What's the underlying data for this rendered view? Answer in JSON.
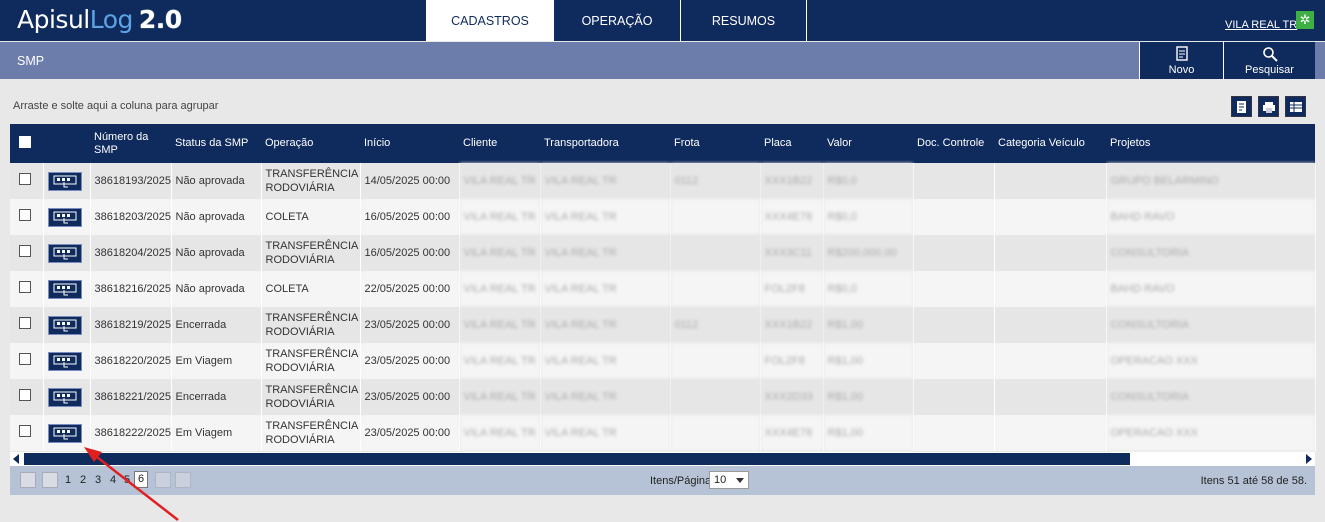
{
  "brand": {
    "name_a": "Apisul",
    "name_b": "Log",
    "version": "2.0"
  },
  "nav": {
    "tabs": [
      {
        "label": "CADASTROS"
      },
      {
        "label": "OPERAÇÃO"
      },
      {
        "label": "RESUMOS"
      }
    ],
    "active": 0
  },
  "user": {
    "name": "VILA REAL TR"
  },
  "section": {
    "title": "SMP",
    "new_label": "Novo",
    "search_label": "Pesquisar"
  },
  "grid": {
    "group_hint": "Arraste e solte aqui a coluna para agrupar",
    "columns": [
      "Número da SMP",
      "Status da SMP",
      "Operação",
      "Início",
      "Cliente",
      "Transportadora",
      "Frota",
      "Placa",
      "Valor",
      "Doc. Controle",
      "Categoria Veículo",
      "Projetos"
    ],
    "rows": [
      {
        "numero": "38618193/2025",
        "status": "Não aprovada",
        "operacao": "TRANSFERÊNCIA RODOVIÁRIA",
        "inicio": "14/05/2025 00:00",
        "cliente": "VILA REAL TR",
        "transportadora": "VILA REAL TR",
        "frota": "0112",
        "placa": "XXX1B22",
        "valor": "R$0,0",
        "projetos": "GRUPO BELARMINO"
      },
      {
        "numero": "38618203/2025",
        "status": "Não aprovada",
        "operacao": "COLETA",
        "inicio": "16/05/2025 00:00",
        "cliente": "VILA REAL TR",
        "transportadora": "VILA REAL TR",
        "frota": "",
        "placa": "XXX4E78",
        "valor": "R$0,0",
        "projetos": "BAHD RAVO"
      },
      {
        "numero": "38618204/2025",
        "status": "Não aprovada",
        "operacao": "TRANSFERÊNCIA RODOVIÁRIA",
        "inicio": "16/05/2025 00:00",
        "cliente": "VILA REAL TR",
        "transportadora": "VILA REAL TR",
        "frota": "",
        "placa": "XXX3C11",
        "valor": "R$200,000.00",
        "projetos": "CONSULTORIA"
      },
      {
        "numero": "38618216/2025",
        "status": "Não aprovada",
        "operacao": "COLETA",
        "inicio": "22/05/2025 00:00",
        "cliente": "VILA REAL TR",
        "transportadora": "VILA REAL TR",
        "frota": "",
        "placa": "FOL2F8",
        "valor": "R$0,0",
        "projetos": "BAHD RAVO"
      },
      {
        "numero": "38618219/2025",
        "status": "Encerrada",
        "operacao": "TRANSFERÊNCIA RODOVIÁRIA",
        "inicio": "23/05/2025 00:00",
        "cliente": "VILA REAL TR",
        "transportadora": "VILA REAL TR",
        "frota": "0112",
        "placa": "XXX1B22",
        "valor": "R$1,00",
        "projetos": "CONSULTORIA"
      },
      {
        "numero": "38618220/2025",
        "status": "Em Viagem",
        "operacao": "TRANSFERÊNCIA RODOVIÁRIA",
        "inicio": "23/05/2025 00:00",
        "cliente": "VILA REAL TR",
        "transportadora": "VILA REAL TR",
        "frota": "",
        "placa": "FOL2F8",
        "valor": "R$1,00",
        "projetos": "OPERACAO XXX"
      },
      {
        "numero": "38618221/2025",
        "status": "Encerrada",
        "operacao": "TRANSFERÊNCIA RODOVIÁRIA",
        "inicio": "23/05/2025 00:00",
        "cliente": "VILA REAL TR",
        "transportadora": "VILA REAL TR",
        "frota": "",
        "placa": "XXX2D33",
        "valor": "R$1,00",
        "projetos": "CONSULTORIA"
      },
      {
        "numero": "38618222/2025",
        "status": "Em Viagem",
        "operacao": "TRANSFERÊNCIA RODOVIÁRIA",
        "inicio": "23/05/2025 00:00",
        "cliente": "VILA REAL TR",
        "transportadora": "VILA REAL TR",
        "frota": "",
        "placa": "XXX4E78",
        "valor": "R$1,00",
        "projetos": "OPERACAO XXX"
      }
    ]
  },
  "pager": {
    "pages": [
      "1",
      "2",
      "3",
      "4",
      "5"
    ],
    "current": "6",
    "items_label": "Itens/Página:",
    "page_size": "10",
    "info": "Itens 51 até 58 de 58."
  },
  "icons": {
    "new": "document-icon",
    "search": "search-icon",
    "settings": "gear-icon",
    "row_action": "hand-pointer-icon"
  },
  "colors": {
    "primary": "#0f2a5c",
    "subbar": "#6c7cab",
    "pager": "#b6c3d6",
    "annotation": "#e02020"
  }
}
